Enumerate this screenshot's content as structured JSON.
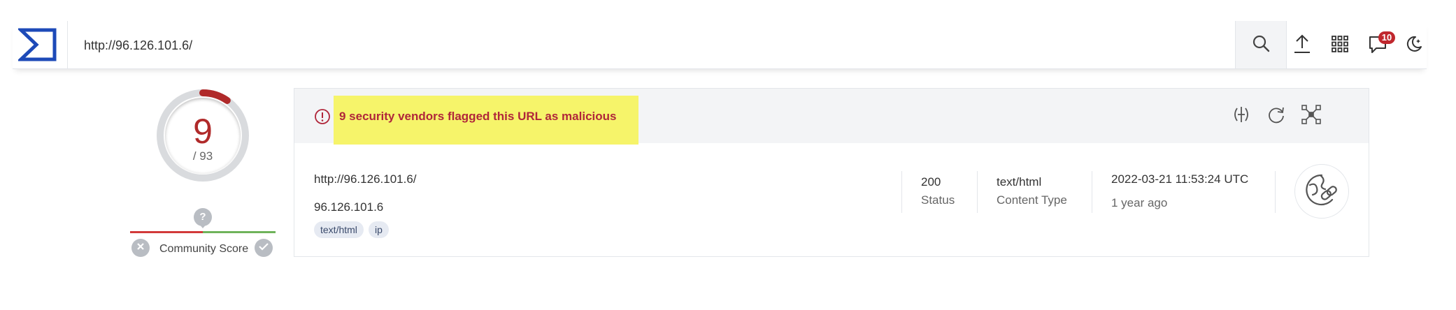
{
  "topbar": {
    "logo_icon": "virustotal-logo-icon",
    "search_value": "http://96.126.101.6/",
    "search_icon": "search-icon",
    "upload_icon": "upload-icon",
    "apps_icon": "apps-grid-icon",
    "notifications_icon": "chat-bubble-icon",
    "notification_count": "10",
    "theme_icon": "moon-icon"
  },
  "score": {
    "detections": "9",
    "total": "/ 93",
    "detection_ratio": 0.0968,
    "colors": {
      "malicious": "#b02a2a",
      "track": "#d9dbde"
    }
  },
  "community": {
    "help_glyph": "?",
    "label": "Community Score",
    "down_icon": "close-icon",
    "up_icon": "check-icon"
  },
  "alert": {
    "icon": "alert-circle-icon",
    "text": "9 security vendors flagged this URL as malicious",
    "highlight_color": "#f6f46a",
    "text_color": "#b0263a"
  },
  "actions": {
    "compare_icon": "compare-icon",
    "reanalyze_icon": "reanalyze-icon",
    "graph_icon": "graph-icon"
  },
  "details": {
    "url": "http://96.126.101.6/",
    "host": "96.126.101.6",
    "tags": [
      "text/html",
      "ip"
    ],
    "status_value": "200",
    "status_label": "Status",
    "content_type_value": "text/html",
    "content_type_label": "Content Type",
    "scan_date": "2022-03-21 11:53:24 UTC",
    "scan_relative": "1 year ago",
    "type_icon": "url-link-globe-icon"
  }
}
